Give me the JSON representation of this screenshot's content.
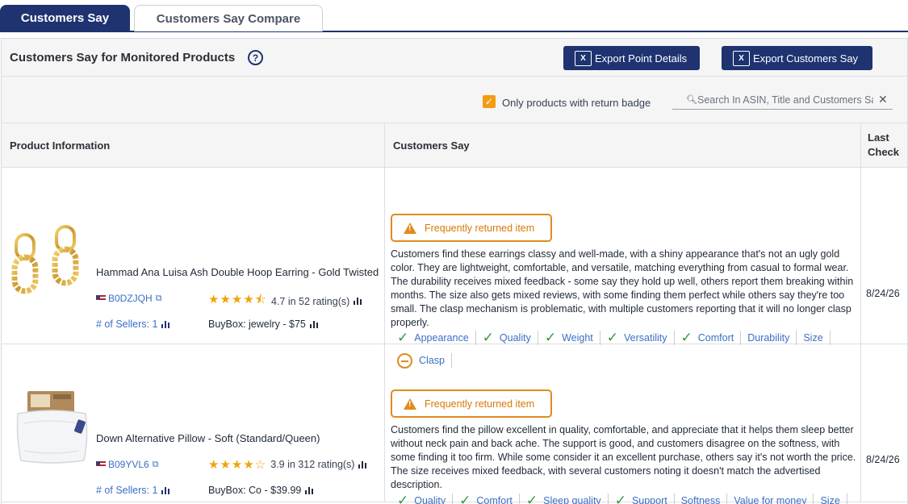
{
  "tabs": [
    {
      "label": "Customers Say",
      "active": true
    },
    {
      "label": "Customers Say Compare",
      "active": false
    }
  ],
  "panel": {
    "title": "Customers Say for Monitored Products",
    "help_icon": "?",
    "export_points_label": "Export Point Details",
    "export_customers_label": "Export Customers Say",
    "excel_icon_glyph": "X"
  },
  "filter": {
    "checkbox_label": "Only products with return badge",
    "checkbox_checked": true,
    "search_placeholder": "Search In ASIN, Title and Customers Say",
    "search_value": ""
  },
  "columns": {
    "product": "Product Information",
    "customers_say": "Customers Say",
    "last_check_line1": "Last",
    "last_check_line2": "Check"
  },
  "rows": [
    {
      "title": "Hammad Ana Luisa Ash Double Hoop Earring - Gold Twisted",
      "asin": "B0DZJQH",
      "rating_value": "4.7 in 52 rating(s)",
      "stars": "★★★★⯪",
      "sellers": "# of Sellers: 1",
      "buybox": "BuyBox: jewelry - $75",
      "badge": "Frequently returned item",
      "summary": "Customers find these earrings classy and well-made, with a shiny appearance that's not an ugly gold color. They are lightweight, comfortable, and versatile, matching everything from casual to formal wear. The durability receives mixed feedback - some say they hold up well, others report them breaking within months. The size also gets mixed reviews, with some finding them perfect while others say they're too small. The clasp mechanism is problematic, with multiple customers reporting that it will no longer clasp properly.",
      "chips": [
        {
          "label": "Appearance",
          "sentiment": "positive"
        },
        {
          "label": "Quality",
          "sentiment": "positive"
        },
        {
          "label": "Weight",
          "sentiment": "positive"
        },
        {
          "label": "Versatility",
          "sentiment": "positive"
        },
        {
          "label": "Comfort",
          "sentiment": "positive"
        },
        {
          "label": "Durability",
          "sentiment": "mixed"
        },
        {
          "label": "Size",
          "sentiment": "mixed"
        },
        {
          "label": "Clasp",
          "sentiment": "negative"
        }
      ],
      "last_check": "8/24/26"
    },
    {
      "title": "Down Alternative Pillow - Soft (Standard/Queen)",
      "asin": "B09YVL6",
      "rating_value": "3.9 in 312 rating(s)",
      "stars": "★★★★☆",
      "sellers": "# of Sellers: 1",
      "buybox": "BuyBox: Co - $39.99",
      "badge": "Frequently returned item",
      "summary": "Customers find the pillow excellent in quality, comfortable, and appreciate that it helps them sleep better without neck pain and back ache. The support is good, and customers disagree on the softness, with some finding it too firm. While some consider it an excellent purchase, others say it's not worth the price. The size receives mixed feedback, with several customers noting it doesn't match the advertised description.",
      "chips": [
        {
          "label": "Quality",
          "sentiment": "positive"
        },
        {
          "label": "Comfort",
          "sentiment": "positive"
        },
        {
          "label": "Sleep quality",
          "sentiment": "positive"
        },
        {
          "label": "Support",
          "sentiment": "positive"
        },
        {
          "label": "Softness",
          "sentiment": "mixed"
        },
        {
          "label": "Value for money",
          "sentiment": "mixed"
        },
        {
          "label": "Size",
          "sentiment": "mixed"
        }
      ],
      "last_check": "8/24/26"
    }
  ],
  "colors": {
    "brand_navy": "#1e3370",
    "accent_orange": "#e08b1e",
    "link_blue": "#3b6fc4",
    "positive_green": "#2e9b3f",
    "star_gold": "#f0a30a"
  },
  "icons": {
    "check": "check-icon",
    "neutral": "neutral-circle-icon",
    "warning": "warning-triangle-icon",
    "search": "search-icon",
    "clear": "close-icon",
    "external": "external-link-icon",
    "chart": "bar-chart-icon",
    "flag": "us-flag-icon",
    "excel": "excel-icon"
  }
}
